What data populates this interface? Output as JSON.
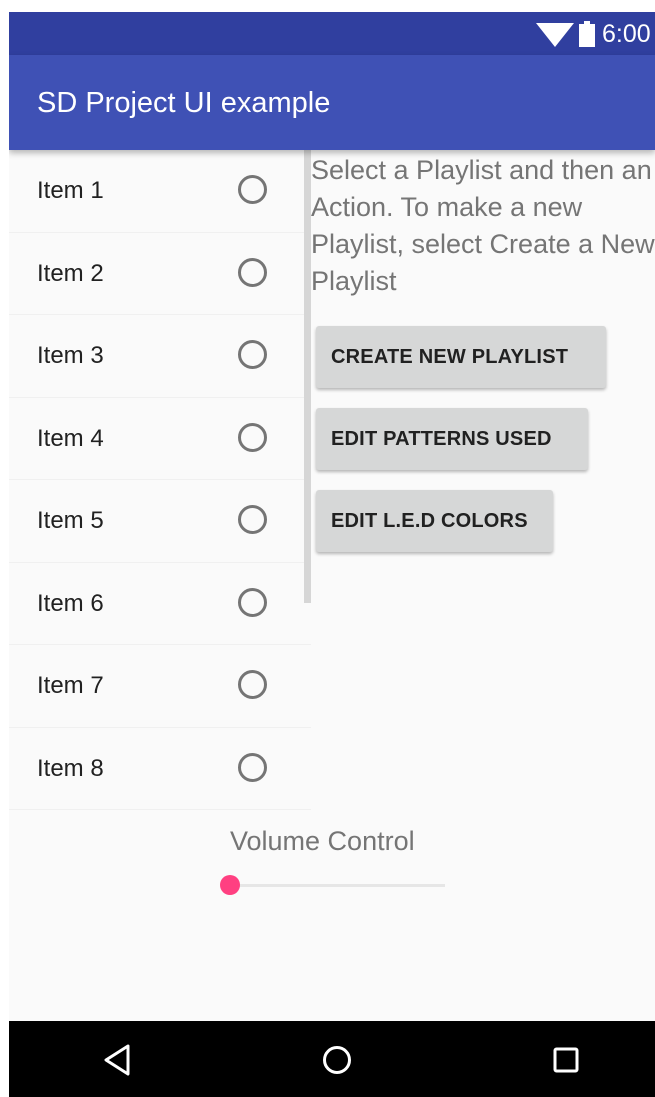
{
  "status_bar": {
    "time": "6:00",
    "wifi_icon": "wifi-icon",
    "battery_icon": "battery-icon"
  },
  "app_bar": {
    "title": "SD Project UI example"
  },
  "playlist_list": {
    "items": [
      {
        "label": "Item 1",
        "checked": false
      },
      {
        "label": "Item 2",
        "checked": false
      },
      {
        "label": "Item 3",
        "checked": false
      },
      {
        "label": "Item 4",
        "checked": false
      },
      {
        "label": "Item 5",
        "checked": false
      },
      {
        "label": "Item 6",
        "checked": false
      },
      {
        "label": "Item 7",
        "checked": false
      },
      {
        "label": "Item 8",
        "checked": false
      }
    ]
  },
  "instructions": {
    "text": "Select a Playlist and then an Action. To make a new Playlist, select Create a New Playlist"
  },
  "actions": {
    "create_label": "CREATE NEW PLAYLIST",
    "patterns_label": "EDIT PATTERNS USED",
    "colors_label": "EDIT L.E.D COLORS"
  },
  "volume": {
    "label": "Volume Control",
    "value_fraction": 0.0
  },
  "nav_bar": {
    "icons": [
      "back-icon",
      "home-icon",
      "recents-icon"
    ]
  },
  "colors": {
    "status_bar": "#303f9f",
    "app_bar": "#3f51b5",
    "accent": "#ff4081",
    "background": "#fafafa",
    "button": "#d6d7d7"
  }
}
